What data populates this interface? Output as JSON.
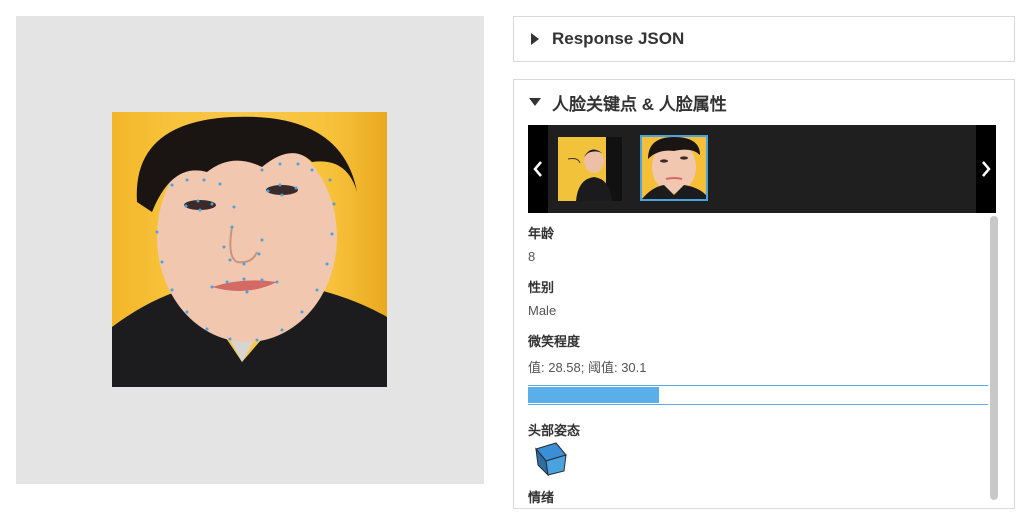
{
  "panels": {
    "response_json": {
      "title": "Response JSON",
      "expanded": false
    },
    "face_attributes": {
      "title": "人脸关键点 & 人脸属性",
      "expanded": true
    }
  },
  "carousel": {
    "prev_icon": "chevron-left-icon",
    "next_icon": "chevron-right-icon",
    "selected_index": 1
  },
  "attributes": {
    "age": {
      "label": "年龄",
      "value": "8"
    },
    "gender": {
      "label": "性别",
      "value": "Male"
    },
    "smile": {
      "label": "微笑程度",
      "text": "值: 28.58; 阈值: 30.1",
      "value": 28.58,
      "threshold": 30.1,
      "max": 100
    },
    "headpose": {
      "label": "头部姿态",
      "icon": "headpose-cube-icon"
    },
    "emotion": {
      "label": "情绪"
    }
  },
  "colors": {
    "accent": "#5aaeea",
    "panel_border": "#d9d9d9",
    "viewer_bg": "#e4e4e4",
    "carousel_bg": "#1f1f1f"
  }
}
